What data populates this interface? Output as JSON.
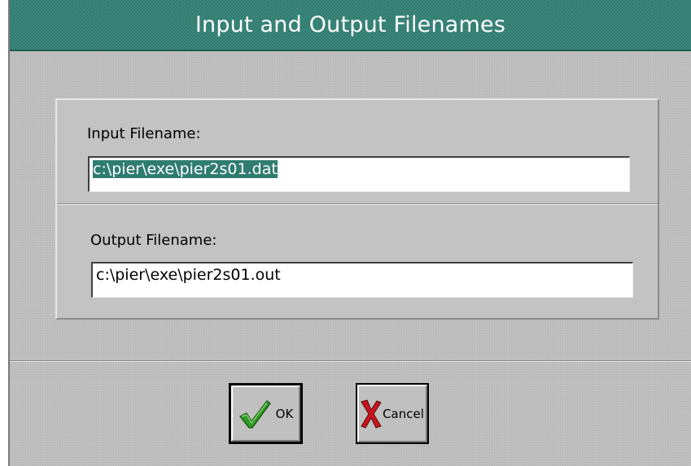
{
  "window": {
    "title": "Input and Output Filenames"
  },
  "input": {
    "label": "Input Filename:",
    "value": "c:\\pier\\exe\\pier2s01.dat"
  },
  "output": {
    "label": "Output Filename:",
    "value": "c:\\pier\\exe\\pier2s01.out"
  },
  "buttons": {
    "ok_label": "OK",
    "cancel_label": "Cancel"
  },
  "icons": {
    "ok": "checkmark-icon",
    "cancel": "x-icon"
  },
  "colors": {
    "titlebar": "#2f7c70",
    "selection": "#2f7c70",
    "checkmark": "#2f9a25",
    "x_mark": "#c8141e"
  }
}
